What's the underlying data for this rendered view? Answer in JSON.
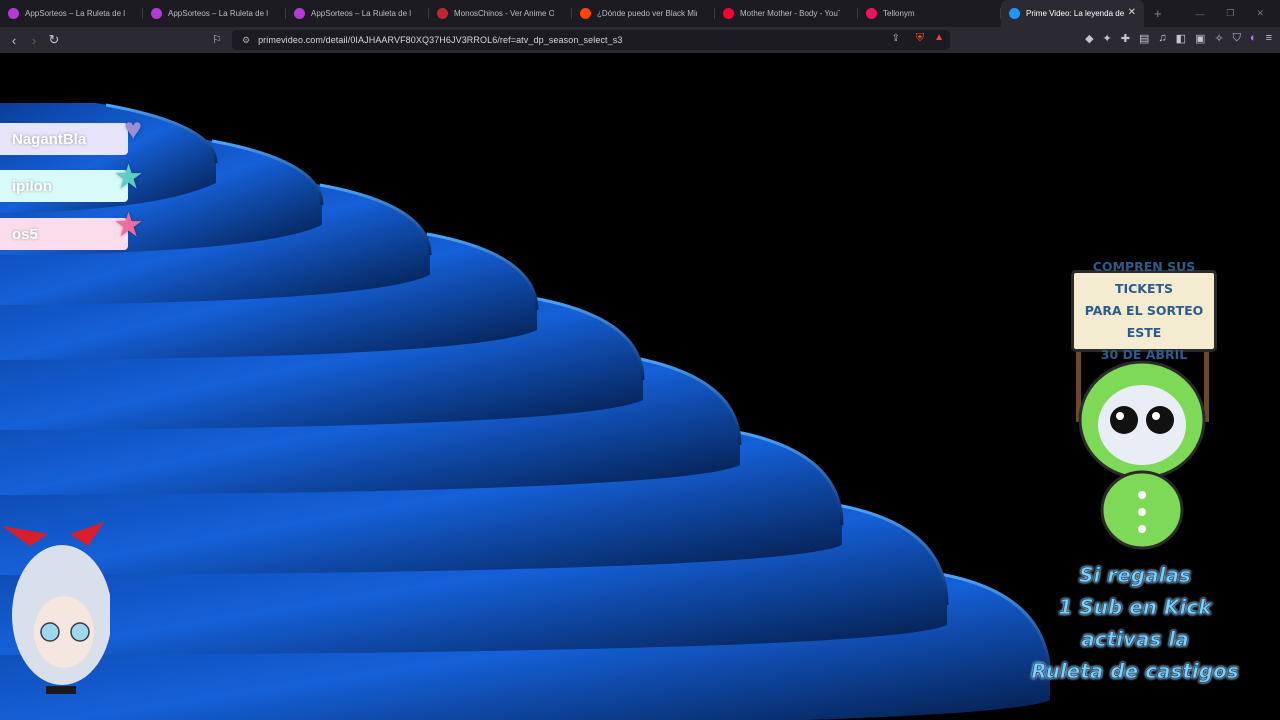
{
  "tabs": [
    {
      "title": "AppSorteos – La Ruleta de la Suerte",
      "color": "#b33ad6",
      "active": false
    },
    {
      "title": "AppSorteos – La Ruleta de la Suerte",
      "color": "#b33ad6",
      "active": false
    },
    {
      "title": "AppSorteos – La Ruleta de la Suerte",
      "color": "#b33ad6",
      "active": false
    },
    {
      "title": "MonosChinos - Ver Anime Online",
      "color": "#c0262d",
      "active": false
    },
    {
      "title": "¿Dónde puedo ver Black Mirror",
      "color": "#ff4500",
      "active": false
    },
    {
      "title": "Mother Mother - Body - YouTube",
      "color": "#ff0033",
      "active": false
    },
    {
      "title": "Tellonym",
      "color": "#e8175d",
      "active": false
    },
    {
      "title": "Prime Video: La leyenda de",
      "color": "#1a98ff",
      "active": true
    }
  ],
  "address": {
    "url": "primevideo.com/detail/0IAJHAARVF80XQ37H6JV3RROL6/ref=atv_dp_season_select_s3"
  },
  "leaderboard": [
    {
      "name": "NagantBla",
      "bg": "#e8e4fb",
      "star": "#9a8fd6"
    },
    {
      "name": "ipilon",
      "bg": "#d8faf8",
      "star": "#5ccfc4"
    },
    {
      "name": "os5",
      "bg": "#fbdcec",
      "star": "#f06c9c"
    }
  ],
  "sign": {
    "line1": "COMPREN SUS TICKETS",
    "line2": "PARA EL SORTEO ESTE",
    "line3": "30 DE ABRIL"
  },
  "promo": {
    "line1": "Si regalas",
    "line2": "1 Sub en Kick",
    "line3": "activas la",
    "line4": "Ruleta de castigos"
  },
  "icons": {
    "back": "back-arrow-icon",
    "forward": "forward-arrow-icon",
    "reload": "reload-icon",
    "bookmark": "bookmark-icon",
    "site_settings": "site-settings-icon"
  }
}
